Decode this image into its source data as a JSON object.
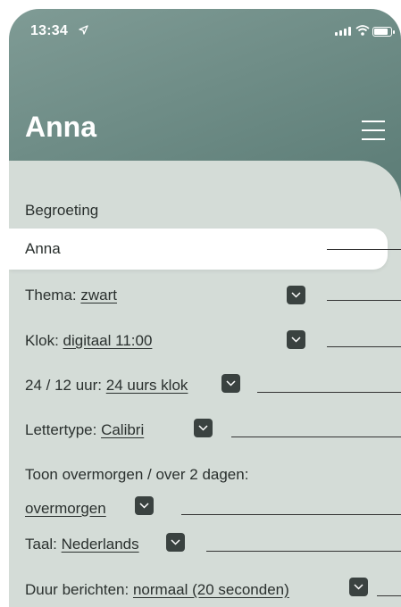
{
  "status_bar": {
    "time": "13:34"
  },
  "header": {
    "title": "Anna"
  },
  "greeting": {
    "label": "Begroeting",
    "value": "Anna"
  },
  "settings": {
    "thema": {
      "label": "Thema:",
      "value": "zwart"
    },
    "klok": {
      "label": "Klok:",
      "value": "digitaal 11:00"
    },
    "uur": {
      "label": "24 / 12 uur:",
      "value": "24 uurs klok"
    },
    "lettertype": {
      "label": "Lettertype:",
      "value": "Calibri"
    },
    "toon": {
      "label": "Toon overmorgen / over 2 dagen:",
      "value": "overmorgen"
    },
    "taal": {
      "label": "Taal:",
      "value": "Nederlands"
    },
    "duur": {
      "label": "Duur berichten:",
      "value": "normaal (20 seconden)"
    }
  },
  "icons": {
    "location": "location-arrow-icon",
    "signal": "cellular-signal-icon",
    "wifi": "wifi-icon",
    "battery": "battery-icon",
    "menu": "hamburger-menu-icon",
    "dropdown": "chevron-down-icon"
  },
  "colors": {
    "header_gradient_start": "#7f9b95",
    "header_gradient_end": "#4a6a66",
    "panel_background": "#d4dcd7",
    "dropdown_button": "#3a4240",
    "text": "#2a302e"
  },
  "battery_level": 0.85
}
